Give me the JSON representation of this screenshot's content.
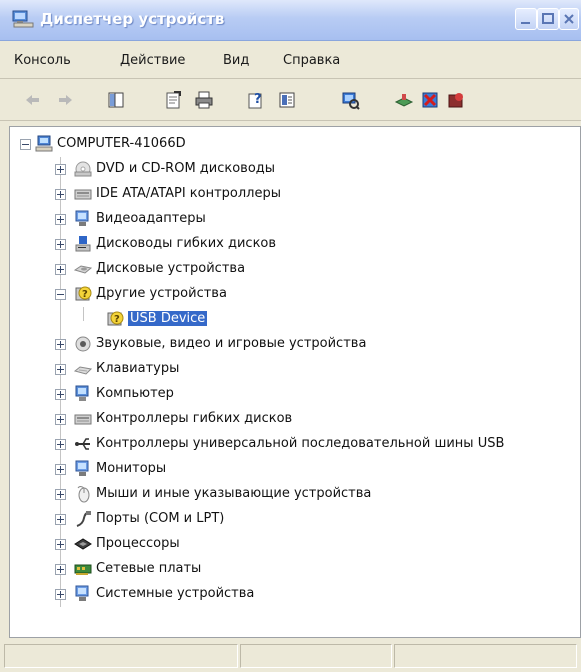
{
  "window": {
    "title": "Диспетчер устройств"
  },
  "menu": {
    "items": [
      "Консоль",
      "Действие",
      "Вид",
      "Справка"
    ]
  },
  "toolbar": {
    "buttons": [
      "back-arrow-icon",
      "forward-arrow-icon",
      "console-tree-icon",
      "properties-icon",
      "print-icon",
      "help-icon",
      "view-icon",
      "scan-hardware-icon",
      "update-driver-icon",
      "uninstall-icon",
      "disable-icon"
    ]
  },
  "tree": {
    "root": "COMPUTER-41066D",
    "items": [
      {
        "label": "DVD и CD-ROM дисководы",
        "icon": "dvd-drive-icon",
        "expanded": false
      },
      {
        "label": "IDE ATA/ATAPI контроллеры",
        "icon": "ide-controller-icon",
        "expanded": false
      },
      {
        "label": "Видеоадаптеры",
        "icon": "video-adapter-icon",
        "expanded": false
      },
      {
        "label": "Дисководы гибких дисков",
        "icon": "floppy-drive-icon",
        "expanded": false
      },
      {
        "label": "Дисковые устройства",
        "icon": "disk-drive-icon",
        "expanded": false
      },
      {
        "label": "Другие устройства",
        "icon": "unknown-device-icon",
        "expanded": true
      },
      {
        "label": "USB Device",
        "icon": "unknown-device-icon",
        "child": true,
        "selected": true
      },
      {
        "label": "Звуковые, видео и игровые устройства",
        "icon": "sound-icon",
        "expanded": false
      },
      {
        "label": "Клавиатуры",
        "icon": "keyboard-icon",
        "expanded": false
      },
      {
        "label": "Компьютер",
        "icon": "computer-icon",
        "expanded": false
      },
      {
        "label": "Контроллеры гибких дисков",
        "icon": "floppy-controller-icon",
        "expanded": false
      },
      {
        "label": "Контроллеры универсальной последовательной шины USB",
        "icon": "usb-icon",
        "expanded": false
      },
      {
        "label": "Мониторы",
        "icon": "monitor-icon",
        "expanded": false
      },
      {
        "label": "Мыши и иные указывающие устройства",
        "icon": "mouse-icon",
        "expanded": false
      },
      {
        "label": "Порты (COM и LPT)",
        "icon": "port-icon",
        "expanded": false
      },
      {
        "label": "Процессоры",
        "icon": "processor-icon",
        "expanded": false
      },
      {
        "label": "Сетевые платы",
        "icon": "network-card-icon",
        "expanded": false
      },
      {
        "label": "Системные устройства",
        "icon": "system-device-icon",
        "expanded": false
      }
    ]
  },
  "colors": {
    "selection": "#3569c9",
    "title_bar": "#a7bff0",
    "window_face": "#ece9d8"
  }
}
